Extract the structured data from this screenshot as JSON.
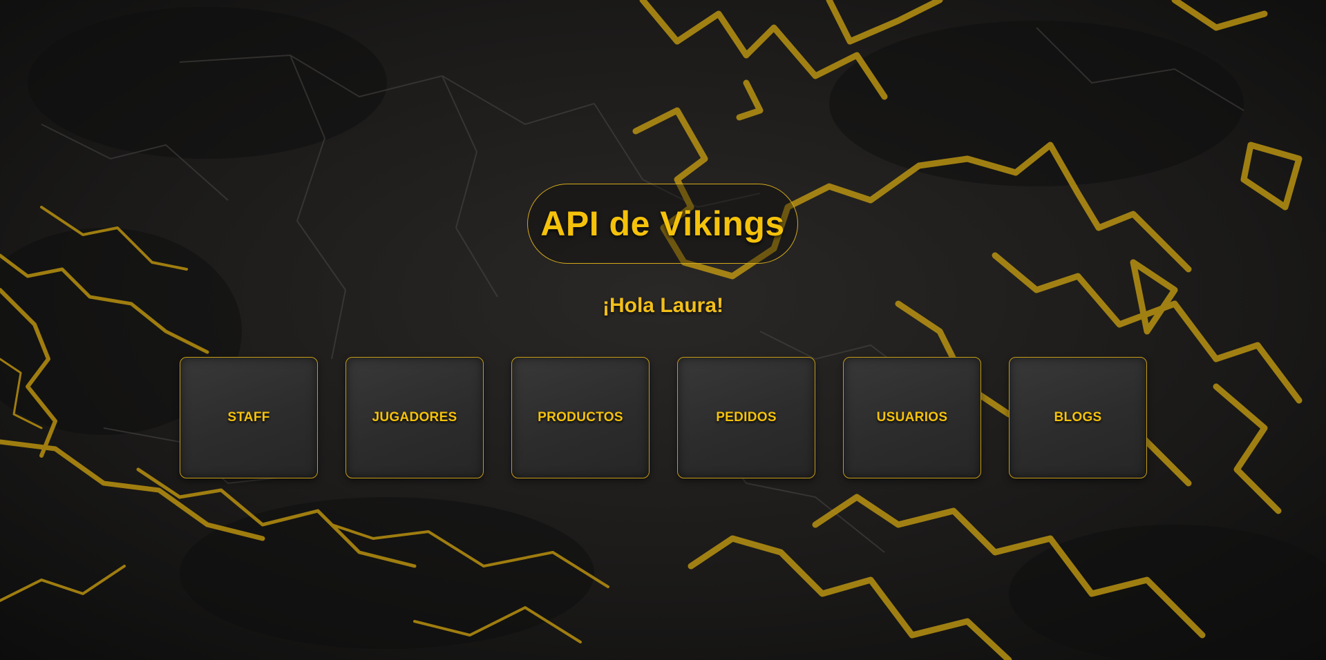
{
  "header": {
    "title": "API de Vikings"
  },
  "greeting": "¡Hola Laura!",
  "menu": {
    "items": [
      {
        "label": "STAFF"
      },
      {
        "label": "JUGADORES"
      },
      {
        "label": "PRODUCTOS"
      },
      {
        "label": "PEDIDOS"
      },
      {
        "label": "USUARIOS"
      },
      {
        "label": "BLOGS"
      }
    ]
  },
  "colors": {
    "accent": "#f5c20b",
    "border": "#c79d14",
    "tile_background": "#2e2e2e",
    "page_background": "#141312"
  }
}
